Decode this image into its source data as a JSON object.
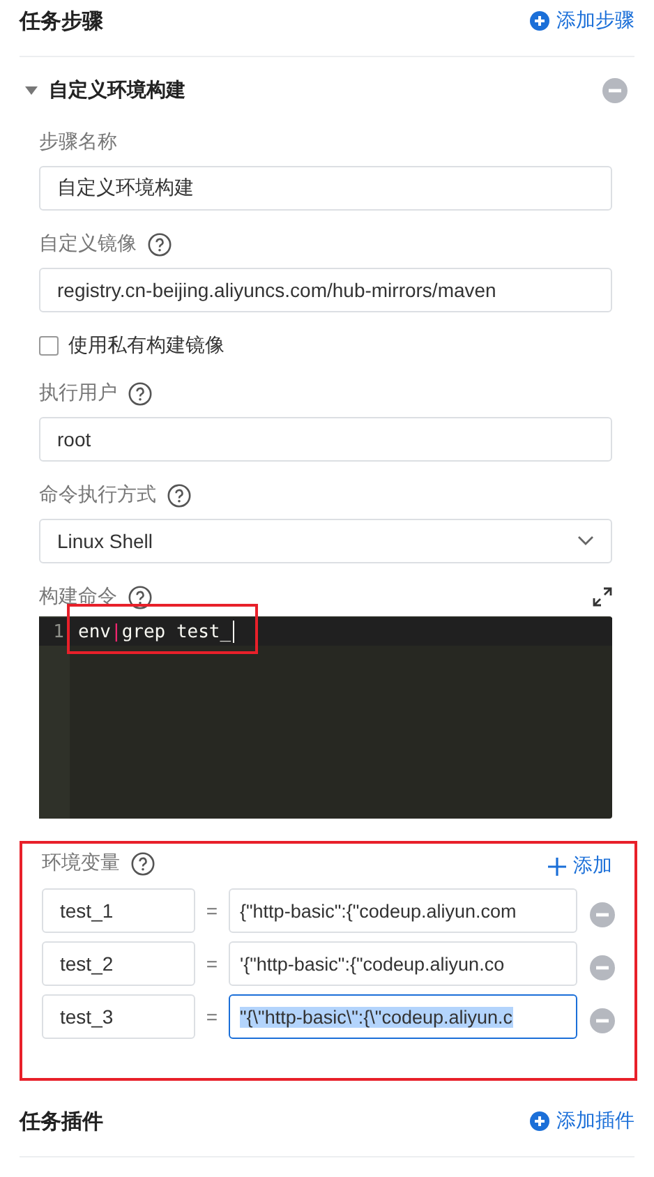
{
  "task_steps": {
    "title": "任务步骤",
    "add_button": "添加步骤"
  },
  "step": {
    "title": "自定义环境构建",
    "expanded": true,
    "fields": [
      {
        "kind": "input",
        "label": "步骤名称",
        "help": false,
        "value": "自定义环境构建"
      },
      {
        "kind": "input",
        "label": "自定义镜像",
        "help": true,
        "value": "registry.cn-beijing.aliyuncs.com/hub-mirrors/maven"
      },
      {
        "kind": "checkbox",
        "label": "使用私有构建镜像",
        "checked": false
      },
      {
        "kind": "input",
        "label": "执行用户",
        "help": true,
        "value": "root"
      },
      {
        "kind": "select",
        "label": "命令执行方式",
        "help": true,
        "value": "Linux Shell"
      },
      {
        "kind": "editor",
        "label": "构建命令",
        "help": true,
        "annotated": true,
        "lines": [
          {
            "number": "1",
            "tokens": [
              {
                "text": "env",
                "kind": "plain"
              },
              {
                "text": "|",
                "kind": "operator"
              },
              {
                "text": "grep test_",
                "kind": "plain"
              }
            ]
          }
        ]
      }
    ]
  },
  "env": {
    "label": "环境变量",
    "help": true,
    "add_button": "添加",
    "annotated": true,
    "rows": [
      {
        "name": "test_1",
        "equals": "=",
        "value": "{\"http-basic\":{\"codeup.aliyun.com",
        "focused": false
      },
      {
        "name": "test_2",
        "equals": "=",
        "value": "'{\"http-basic\":{\"codeup.aliyun.co",
        "focused": false
      },
      {
        "name": "test_3",
        "equals": "=",
        "value": "\"{\\\"http-basic\\\":{\\\"codeup.aliyun.c",
        "focused": true
      }
    ]
  },
  "plugins": {
    "title": "任务插件",
    "add_button": "添加插件"
  }
}
